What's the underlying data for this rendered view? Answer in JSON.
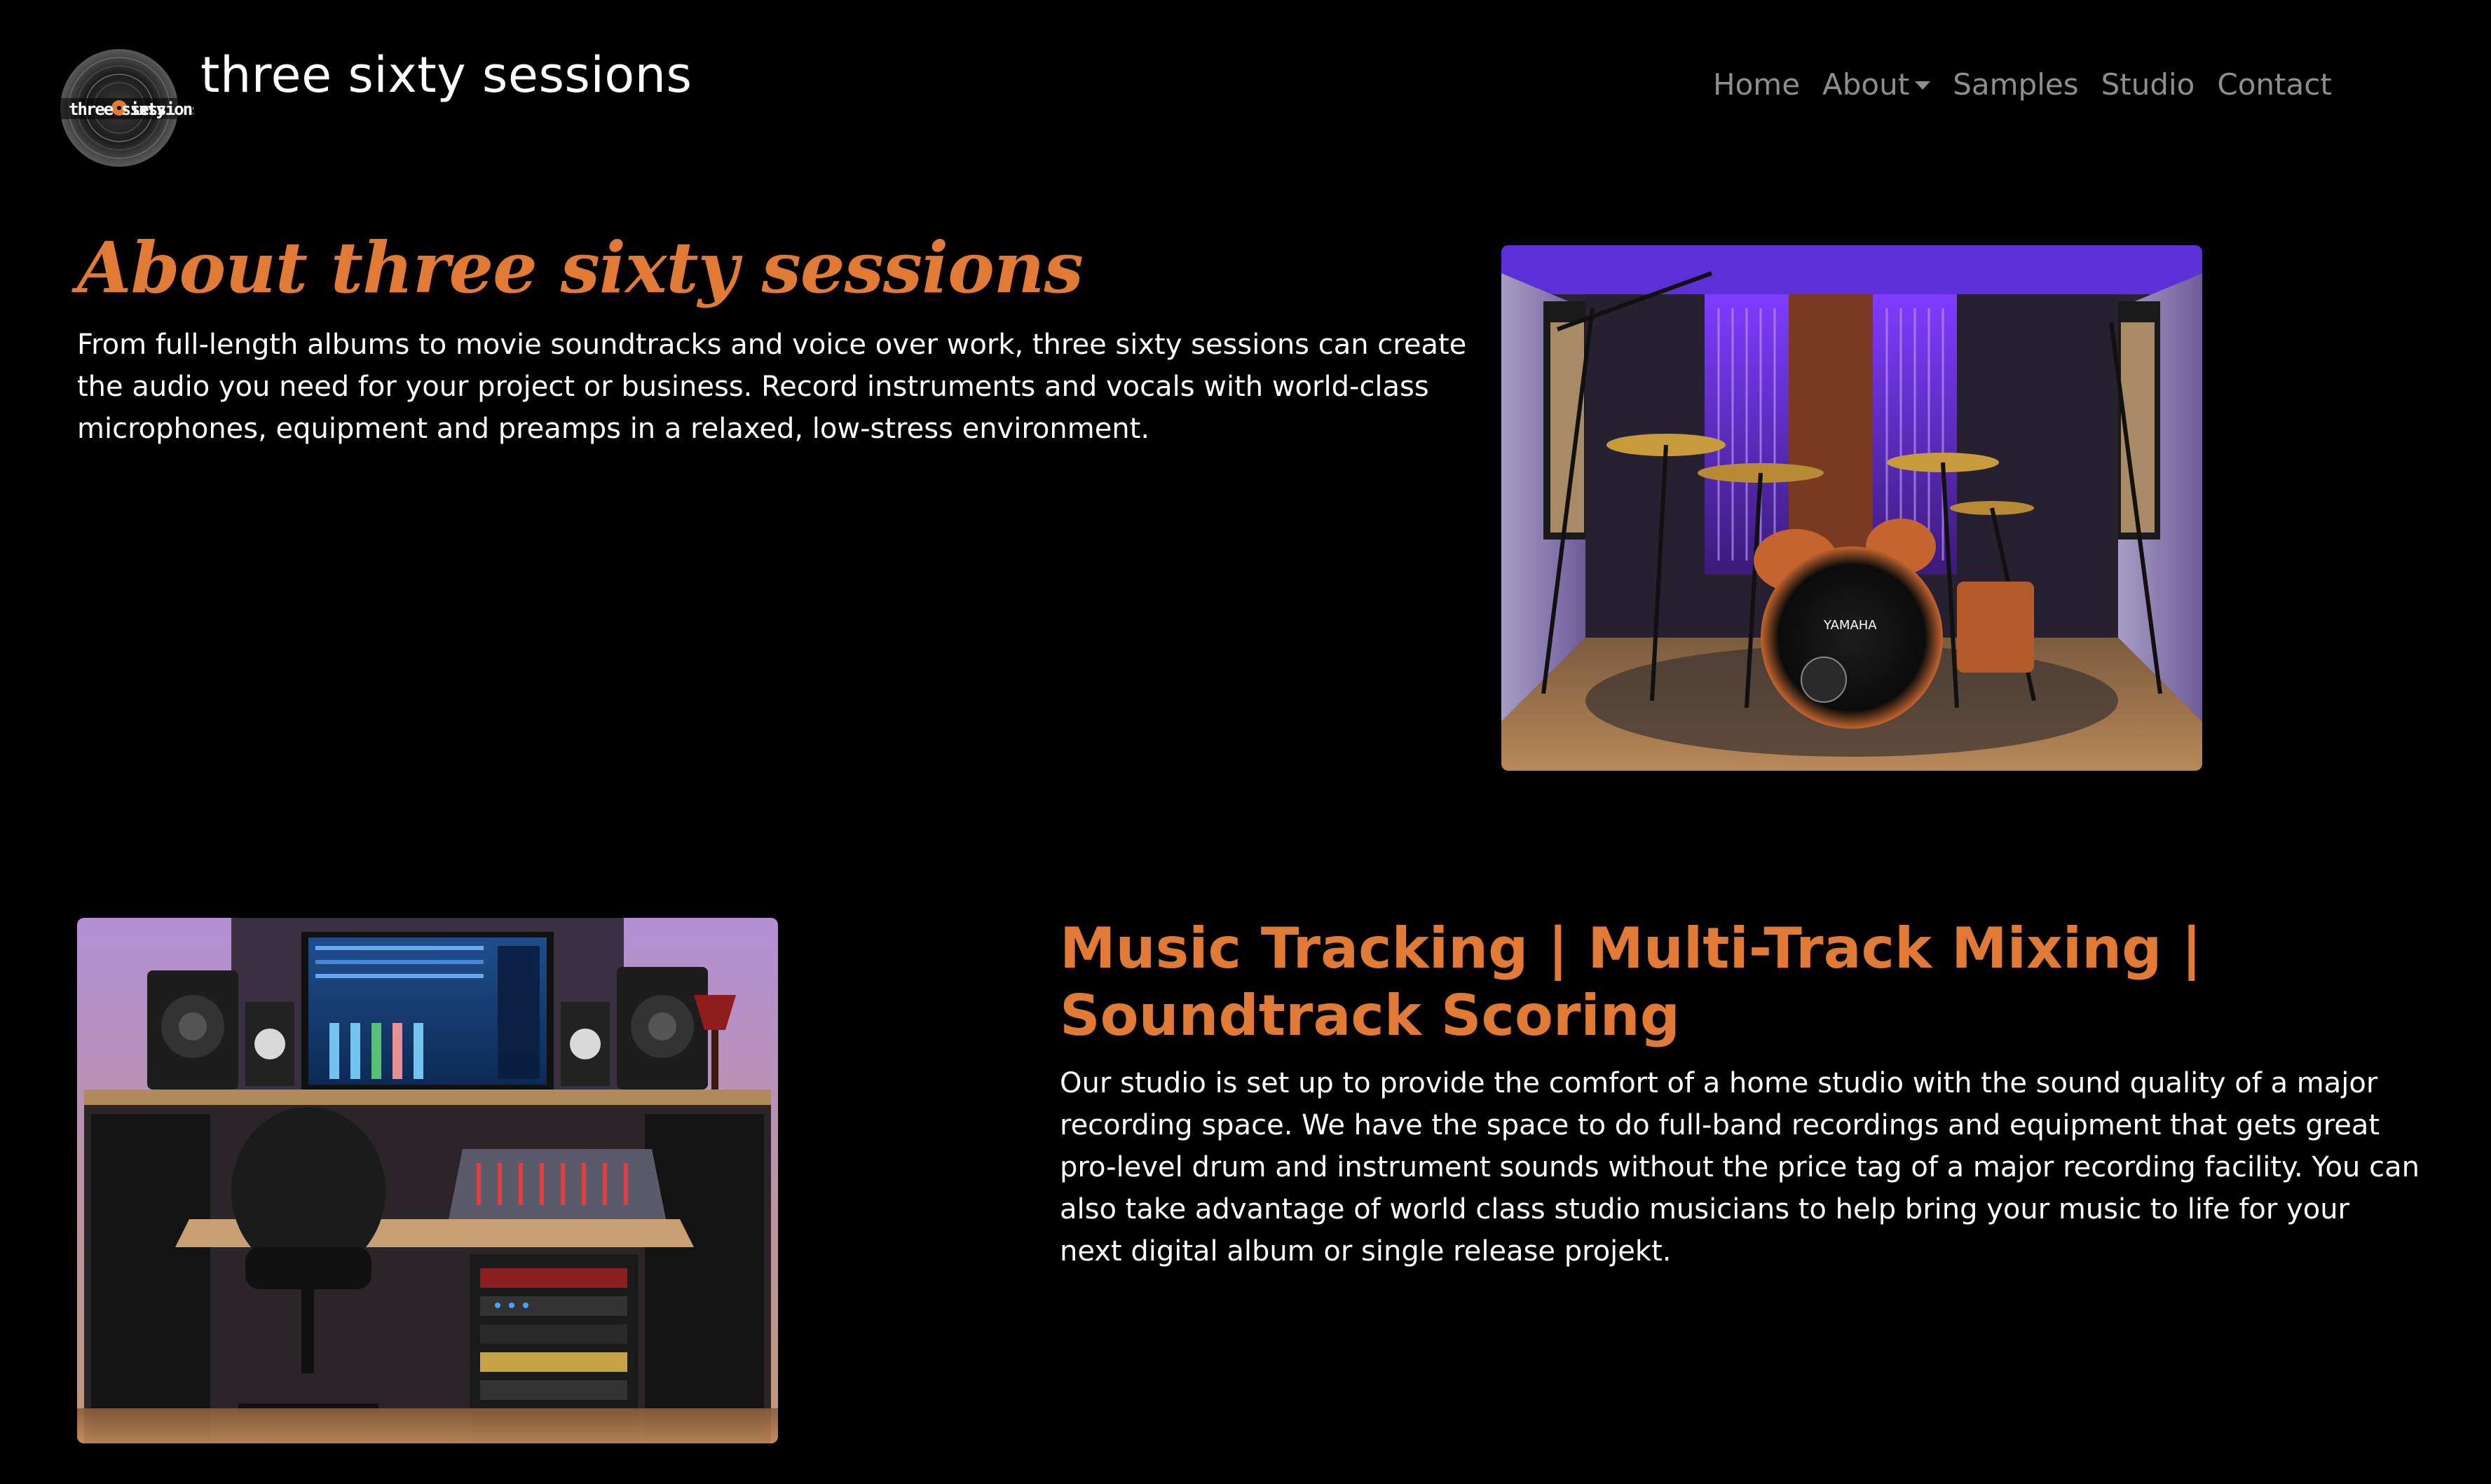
{
  "brand": {
    "name": "three sixty sessions",
    "logo_text": "three sixty sessions",
    "accent_color": "#e07a34"
  },
  "nav": {
    "items": [
      {
        "label": "Home",
        "dropdown": false
      },
      {
        "label": "About",
        "dropdown": true
      },
      {
        "label": "Samples",
        "dropdown": false
      },
      {
        "label": "Studio",
        "dropdown": false
      },
      {
        "label": "Contact",
        "dropdown": false
      }
    ]
  },
  "about": {
    "title": "About three sixty sessions",
    "text": "From full-length albums to movie soundtracks and voice over work, three sixty sessions can create the audio you need for your project or business. Record instruments and vocals with world-class microphones, equipment and preamps in a relaxed, low-stress environment.",
    "image_icon": "drum-kit-photo"
  },
  "services": {
    "title": "Music Tracking | Multi-Track Mixing | Soundtrack Scoring",
    "text": "Our studio is set up to provide the comfort of a home studio with the sound quality of a major recording space. We have the space to do full-band recordings and equipment that gets great pro-level drum and instrument sounds without the price tag of a major recording facility. You can also take advantage of world class studio musicians to help bring your music to life for your next digital album or single release projekt.",
    "image_icon": "mixing-desk-photo"
  }
}
